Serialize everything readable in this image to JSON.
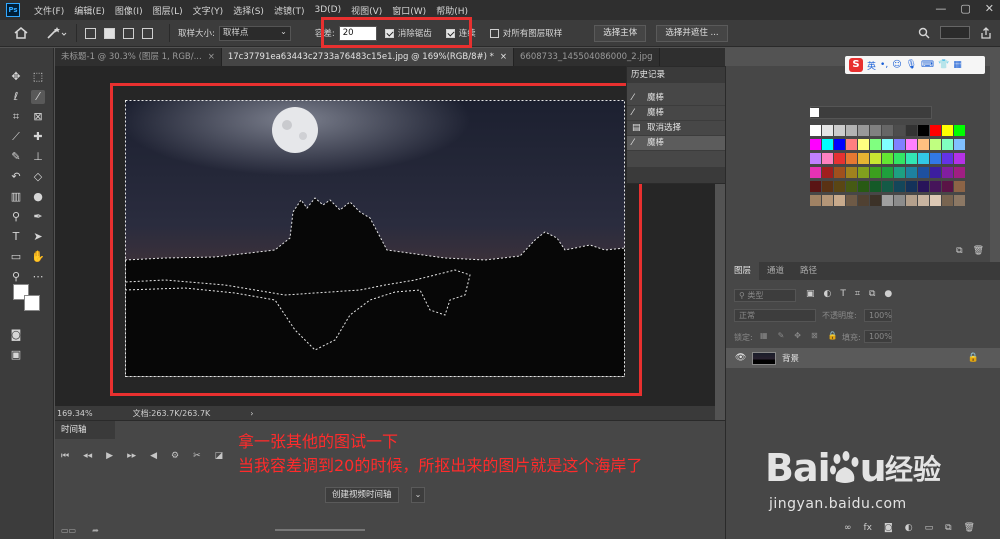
{
  "menubar": {
    "logo": "Ps",
    "items": [
      "文件(F)",
      "编辑(E)",
      "图像(I)",
      "图层(L)",
      "文字(Y)",
      "选择(S)",
      "滤镜(T)",
      "3D(D)",
      "视图(V)",
      "窗口(W)",
      "帮助(H)"
    ],
    "minimize": "—",
    "maximize": "▢",
    "close": "✕"
  },
  "options": {
    "sample_size_label": "取样大小:",
    "sample_size_value": "取样点",
    "tolerance_label": "容差:",
    "tolerance_value": "20",
    "antialias_label": "消除锯齿",
    "antialias_checked": true,
    "contiguous_label": "连续",
    "contiguous_checked": true,
    "all_layers_label": "对所有图层取样",
    "all_layers_checked": false,
    "select_subject": "选择主体",
    "select_mask": "选择并遮住 ..."
  },
  "tabs": [
    {
      "label": "未标题-1 @ 30.3% (图层 1, RGB/...",
      "close": "×",
      "active": false
    },
    {
      "label": "17c37791ea63443c2733a76483c15e1.jpg @ 169%(RGB/8#) *",
      "close": "×",
      "active": true
    },
    {
      "label": "6608733_145504086000_2.jpg",
      "close": "",
      "active": false
    }
  ],
  "status": {
    "zoom": "169.34%",
    "doc": "文档:263.7K/263.7K",
    "arrow": "›"
  },
  "history": {
    "title": "历史记录",
    "items": [
      {
        "label": "魔棒",
        "icon": "magic-wand-icon",
        "active": false
      },
      {
        "label": "魔棒",
        "icon": "magic-wand-icon",
        "active": false
      },
      {
        "label": "取消选择",
        "icon": "document-icon",
        "active": false
      },
      {
        "label": "魔棒",
        "icon": "magic-wand-icon",
        "active": true
      }
    ]
  },
  "sogou": {
    "logo": "S",
    "mode": "英"
  },
  "layers": {
    "tabs": [
      "图层",
      "通道",
      "路径"
    ],
    "filter_kind": "类型",
    "blend_mode": "正常",
    "opacity_label": "不透明度:",
    "opacity_value": "100%",
    "lock_label": "锁定:",
    "fill_label": "填充:",
    "fill_value": "100%",
    "layer_name": "背景"
  },
  "timeline": {
    "title": "时间轴",
    "create_button": "创建视频时间轴",
    "dropdown": "⌄"
  },
  "annotation": {
    "line1": "拿一张其他的图试一下",
    "line2": "当我容差调到20的时候，所抠出来的图片就是这个海岸了"
  },
  "watermark": {
    "brand": "Bai",
    "brand_tail": "u",
    "cn": "经验",
    "url": "jingyan.baidu.com"
  },
  "colors": {
    "highlight": "#e8302f",
    "annotation": "#ff2b2b"
  }
}
